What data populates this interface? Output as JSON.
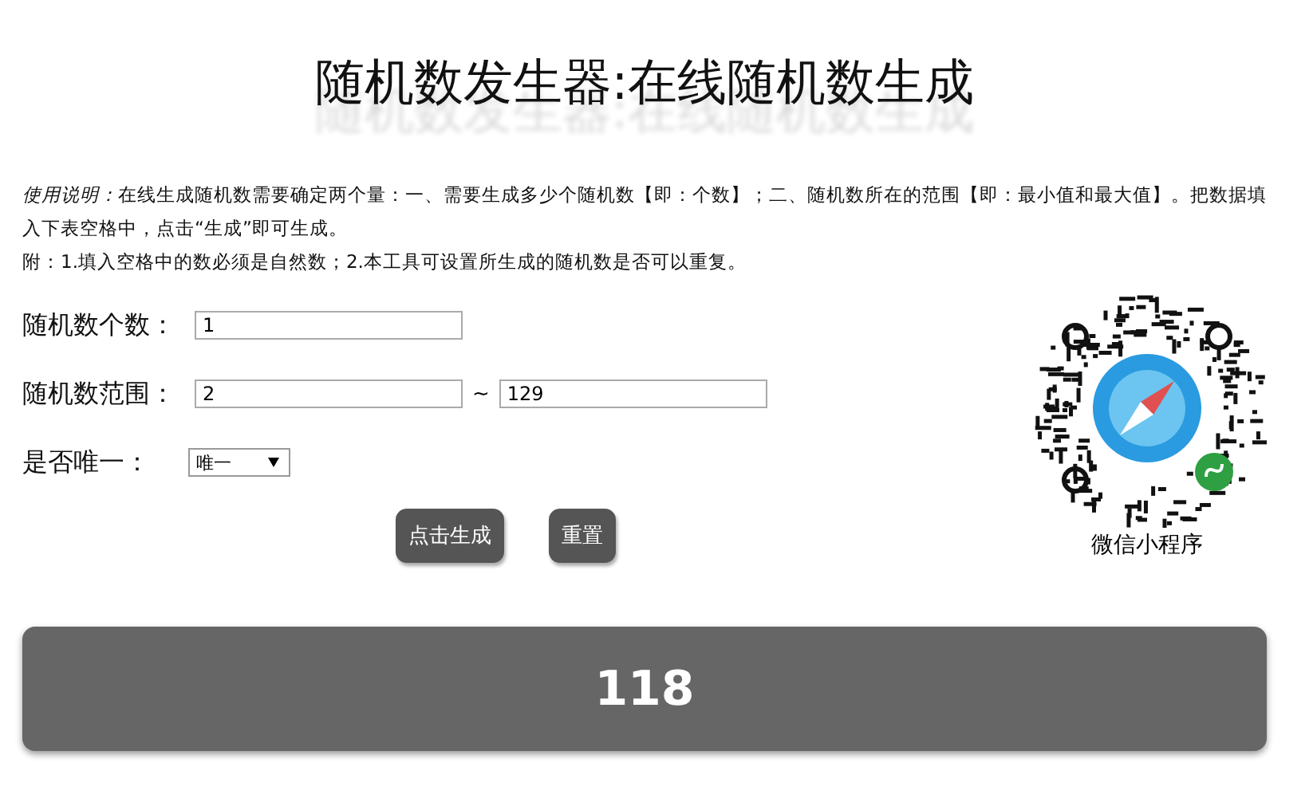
{
  "title": "随机数发生器:在线随机数生成",
  "instructions_lead": "使用说明：",
  "instructions": [
    "在线生成随机数需要确定两个量：一、需要生成多少个随机数【即：个数】；二、随机数所在的范围【即：最小值和最大值】。把数据填入下表空格中，点击“生成”即可生成。",
    "附：1.填入空格中的数必须是自然数；2.本工具可设置所生成的随机数是否可以重复。"
  ],
  "form": {
    "count_label": "随机数个数：",
    "count_value": "1",
    "range_label": "随机数范围：",
    "range_min": "2",
    "range_separator": "~",
    "range_max": "129",
    "unique_label": "是否唯一：",
    "unique_value": "唯一"
  },
  "buttons": [
    {
      "label": "点击生成"
    },
    {
      "label": "重置"
    }
  ],
  "qr_caption": "微信小程序",
  "result": "118"
}
